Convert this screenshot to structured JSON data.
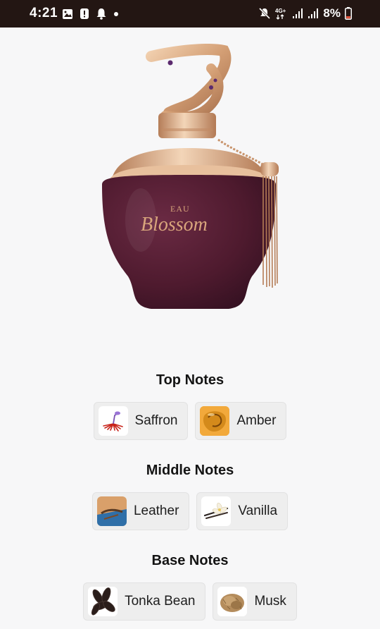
{
  "status_bar": {
    "time": "4:21",
    "battery_percent": "8%",
    "network": "4G+",
    "left_icons": [
      "image-icon",
      "alert-icon",
      "bell-icon",
      "dot-icon"
    ],
    "right_icons": [
      "mute-icon",
      "4g-icon",
      "signal-icon",
      "signal-icon",
      "battery-icon"
    ]
  },
  "product": {
    "bottle_text_line1": "EAU",
    "bottle_text_line2": "Blossom"
  },
  "notes": {
    "top": {
      "title": "Top Notes",
      "items": [
        {
          "label": "Saffron",
          "icon": "saffron-image"
        },
        {
          "label": "Amber",
          "icon": "amber-image"
        }
      ]
    },
    "middle": {
      "title": "Middle Notes",
      "items": [
        {
          "label": "Leather",
          "icon": "leather-image"
        },
        {
          "label": "Vanilla",
          "icon": "vanilla-image"
        }
      ]
    },
    "base": {
      "title": "Base Notes",
      "items": [
        {
          "label": "Tonka Bean",
          "icon": "tonka-bean-image"
        },
        {
          "label": "Musk",
          "icon": "musk-image"
        }
      ]
    }
  },
  "colors": {
    "status_bar_bg": "#231613",
    "page_bg": "#f7f7f8",
    "chip_bg": "#eeeeee",
    "bottle_body": "#4e1a2e",
    "bottle_gold": "#d8a57c",
    "battery_low": "#e0533a"
  }
}
